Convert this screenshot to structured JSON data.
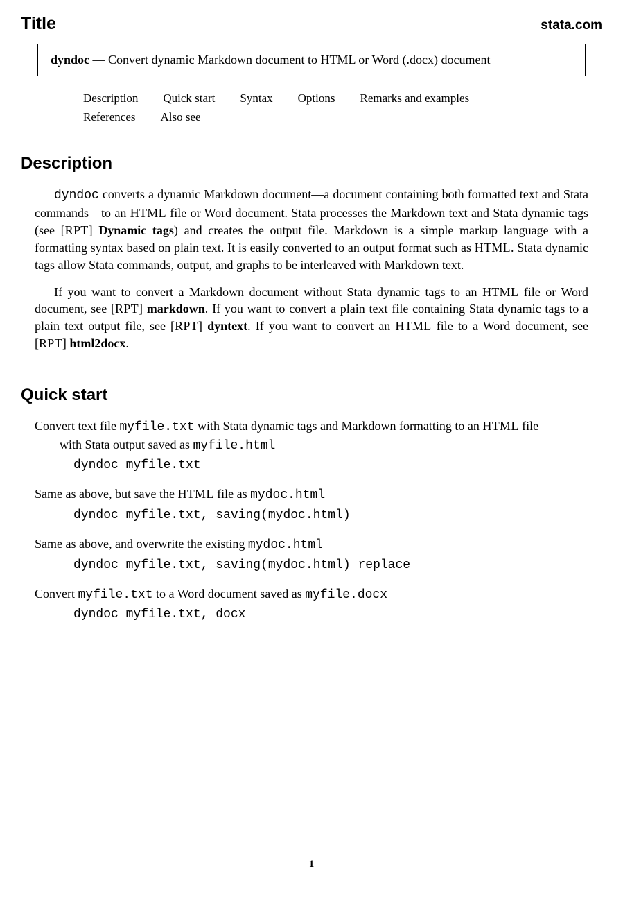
{
  "header": {
    "title": "Title",
    "brand": "stata.com"
  },
  "titlebox": {
    "command": "dyndoc",
    "sep": " — ",
    "summary": "Convert dynamic Markdown document to HTML or Word (.docx) document"
  },
  "nav": {
    "row1": {
      "a": "Description",
      "b": "Quick start",
      "c": "Syntax",
      "d": "Options",
      "e": "Remarks and examples"
    },
    "row2": {
      "a": "References",
      "b": "Also see"
    }
  },
  "description": {
    "heading": "Description",
    "p1_a": "dyndoc",
    "p1_b": " converts a dynamic Markdown document—a document containing both formatted text and Stata commands—to an ",
    "p1_c": "HTML",
    "p1_d": " file or Word document. Stata processes the Markdown text and Stata dynamic tags (see [",
    "p1_e": "RPT",
    "p1_f": "] ",
    "p1_g": "Dynamic tags",
    "p1_h": ") and creates the output file. Markdown is a simple markup language with a formatting syntax based on plain text. It is easily converted to an output format such as ",
    "p1_i": "HTML",
    "p1_j": ". Stata dynamic tags allow Stata commands, output, and graphs to be interleaved with Markdown text.",
    "p2_a": "If you want to convert a Markdown document without Stata dynamic tags to an ",
    "p2_b": "HTML",
    "p2_c": " file or Word document, see [",
    "p2_d": "RPT",
    "p2_e": "] ",
    "p2_f": "markdown",
    "p2_g": ". If you want to convert a plain text file containing Stata dynamic tags to a plain text output file, see [",
    "p2_h": "RPT",
    "p2_i": "] ",
    "p2_j": "dyntext",
    "p2_k": ". If you want to convert an ",
    "p2_l": "HTML",
    "p2_m": " file to a Word document, see [",
    "p2_n": "RPT",
    "p2_o": "] ",
    "p2_p": "html2docx",
    "p2_q": "."
  },
  "quickstart": {
    "heading": "Quick start",
    "item1": {
      "d1": "Convert text file ",
      "d2": "myfile.txt",
      "d3": " with Stata dynamic tags and Markdown formatting to an ",
      "d4": "HTML",
      "d5": " file",
      "cont1": "with Stata output saved as ",
      "cont2": "myfile.html",
      "cmd": "dyndoc myfile.txt"
    },
    "item2": {
      "d1": "Same as above, but save the ",
      "d2": "HTML",
      "d3": " file as ",
      "d4": "mydoc.html",
      "cmd": "dyndoc myfile.txt, saving(mydoc.html)"
    },
    "item3": {
      "d1": "Same as above, and overwrite the existing ",
      "d2": "mydoc.html",
      "cmd": "dyndoc myfile.txt, saving(mydoc.html) replace"
    },
    "item4": {
      "d1": "Convert ",
      "d2": "myfile.txt",
      "d3": " to a Word document saved as ",
      "d4": "myfile.docx",
      "cmd": "dyndoc myfile.txt, docx"
    }
  },
  "page_number": "1"
}
